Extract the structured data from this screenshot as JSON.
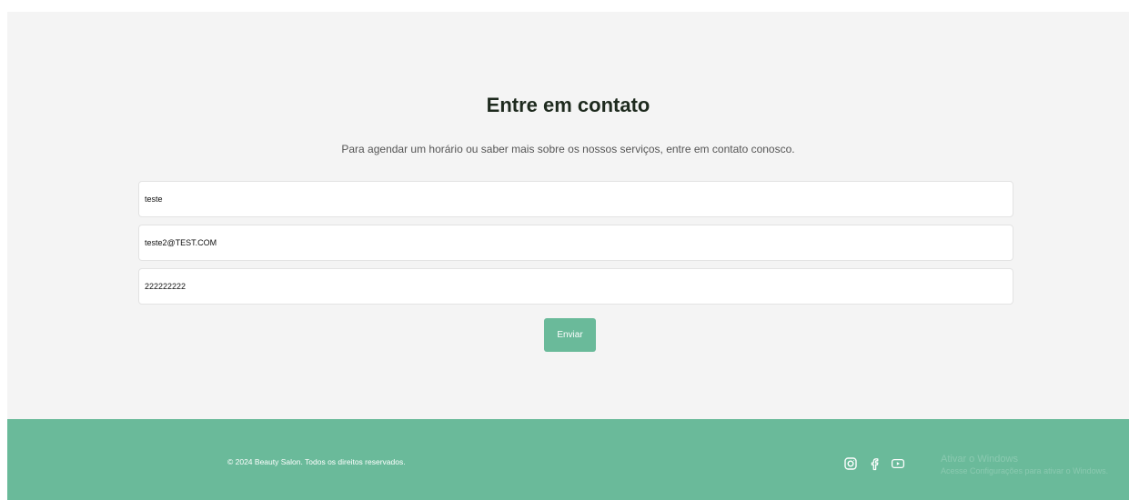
{
  "contact": {
    "title": "Entre em contato",
    "subtitle": "Para agendar um horário ou saber mais sobre os nossos serviços, entre em contato conosco.",
    "fields": {
      "name": {
        "value": "teste"
      },
      "email": {
        "value": "teste2@TEST.COM"
      },
      "phone": {
        "value": "222222222"
      }
    },
    "submit_label": "Enviar"
  },
  "footer": {
    "copyright": "© 2024 Beauty Salon. Todos os direitos reservados.",
    "social": [
      "instagram-icon",
      "facebook-icon",
      "youtube-icon"
    ]
  },
  "overlay": {
    "title": "Ativar o Windows",
    "subtitle": "Acesse Configurações para ativar o Windows."
  },
  "colors": {
    "accent": "#6aba9a",
    "section_background": "#f4f4f4",
    "heading": "#1e2a1e"
  }
}
